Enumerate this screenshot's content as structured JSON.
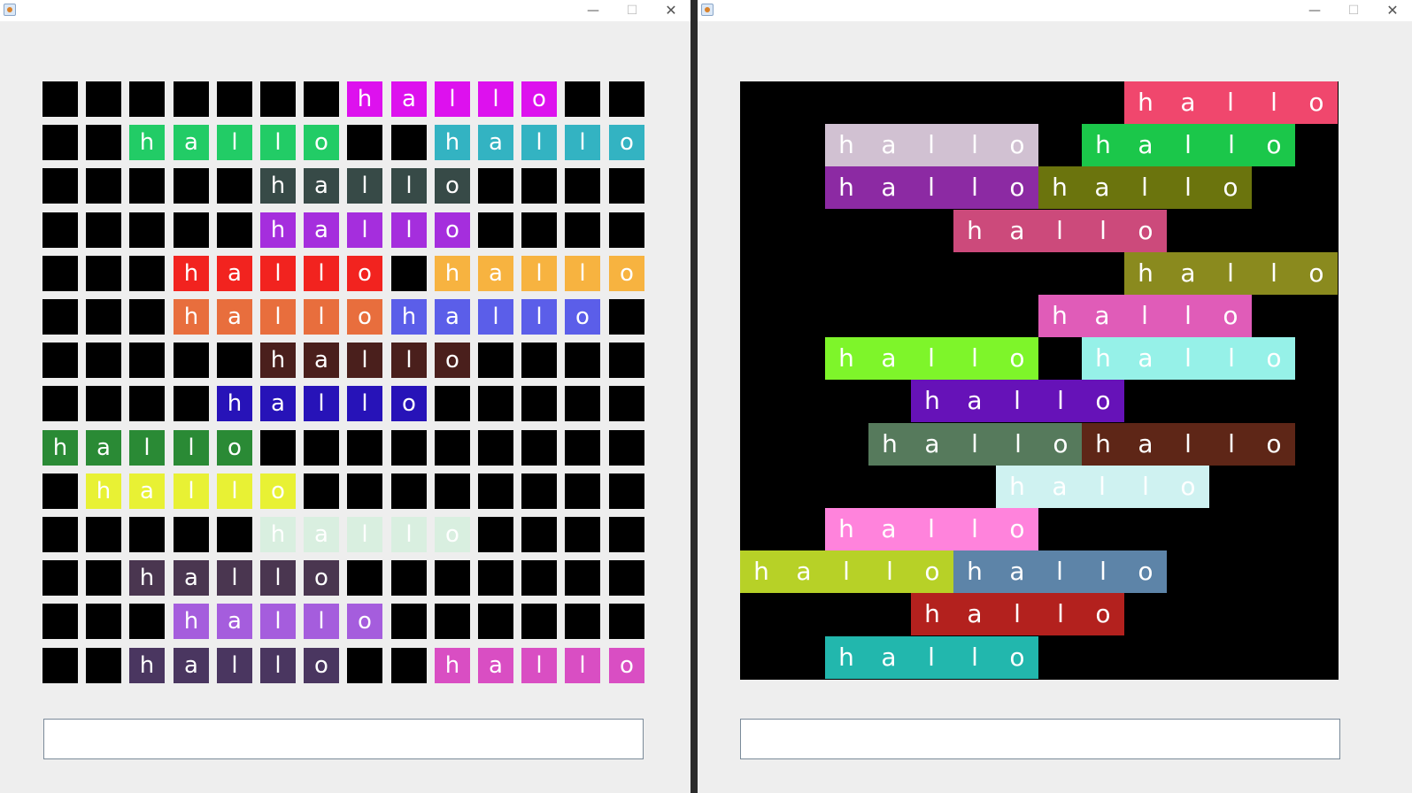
{
  "windows": [
    {
      "title_controls": {
        "minimize": "—",
        "maximize": "☐",
        "close": "✕"
      },
      "grid": {
        "letters": [
          "h",
          "a",
          "l",
          "l",
          "o"
        ],
        "empty_color": "#000000",
        "words": [
          {
            "row": 0,
            "col": 7,
            "color": "#dd11ee"
          },
          {
            "row": 1,
            "col": 2,
            "color": "#22cc66"
          },
          {
            "row": 1,
            "col": 9,
            "color": "#33b3c2"
          },
          {
            "row": 2,
            "col": 5,
            "color": "#374a47"
          },
          {
            "row": 3,
            "col": 5,
            "color": "#a52edd"
          },
          {
            "row": 4,
            "col": 3,
            "color": "#f2231f"
          },
          {
            "row": 4,
            "col": 9,
            "color": "#f7b340"
          },
          {
            "row": 5,
            "col": 3,
            "color": "#e86e3d"
          },
          {
            "row": 5,
            "col": 8,
            "color": "#5b5ee9"
          },
          {
            "row": 6,
            "col": 5,
            "color": "#4a1f1c"
          },
          {
            "row": 7,
            "col": 4,
            "color": "#2713b8"
          },
          {
            "row": 8,
            "col": 0,
            "color": "#2a8a35"
          },
          {
            "row": 9,
            "col": 1,
            "color": "#e8f134"
          },
          {
            "row": 10,
            "col": 5,
            "color": "#d9efe0"
          },
          {
            "row": 11,
            "col": 2,
            "color": "#4a3650"
          },
          {
            "row": 12,
            "col": 3,
            "color": "#a55ddd"
          },
          {
            "row": 13,
            "col": 2,
            "color": "#4a3660"
          },
          {
            "row": 13,
            "col": 9,
            "color": "#d94ec3"
          }
        ]
      },
      "input": {
        "value": ""
      }
    },
    {
      "title_controls": {
        "minimize": "—",
        "maximize": "☐",
        "close": "✕"
      },
      "board": {
        "letters": [
          "h",
          "a",
          "l",
          "l",
          "o"
        ],
        "background": "#000000",
        "words": [
          {
            "row": 0,
            "col": 9,
            "color": "#f0476d"
          },
          {
            "row": 1,
            "col": 2,
            "color": "#d1c1d2"
          },
          {
            "row": 1,
            "col": 8,
            "color": "#1bc74a"
          },
          {
            "row": 2,
            "col": 2,
            "color": "#8c2aa3"
          },
          {
            "row": 2,
            "col": 7,
            "color": "#6b740d"
          },
          {
            "row": 3,
            "col": 5,
            "color": "#cc4a7b"
          },
          {
            "row": 4,
            "col": 9,
            "color": "#8a8a1e"
          },
          {
            "row": 5,
            "col": 7,
            "color": "#e05cb8"
          },
          {
            "row": 6,
            "col": 2,
            "color": "#7ef52a"
          },
          {
            "row": 6,
            "col": 8,
            "color": "#96f1e8"
          },
          {
            "row": 7,
            "col": 4,
            "color": "#6612b8"
          },
          {
            "row": 8,
            "col": 3,
            "color": "#567a5c"
          },
          {
            "row": 8,
            "col": 8,
            "color": "#5e2617"
          },
          {
            "row": 9,
            "col": 6,
            "color": "#cff2f1"
          },
          {
            "row": 10,
            "col": 2,
            "color": "#ff83dc"
          },
          {
            "row": 11,
            "col": 0,
            "color": "#b7d127"
          },
          {
            "row": 11,
            "col": 5,
            "color": "#5d84a8"
          },
          {
            "row": 12,
            "col": 4,
            "color": "#b3211e"
          },
          {
            "row": 13,
            "col": 2,
            "color": "#22b7ad"
          }
        ]
      },
      "input": {
        "value": ""
      }
    }
  ]
}
